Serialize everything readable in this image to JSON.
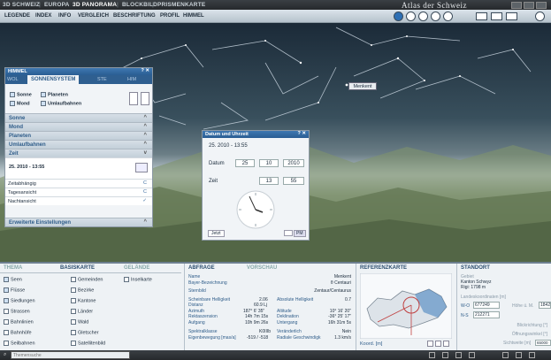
{
  "topbar": {
    "tabs": [
      "3D",
      "SCHWEIZ",
      "EUROPA",
      "3D",
      "PANORAMA",
      "BLOCKBILD",
      "PRISMENKARTE"
    ],
    "app_title": "Atlas der Schweiz"
  },
  "menu": [
    "LEGENDE",
    "INDEX",
    "INFO",
    "VERGLEICH",
    "BESCHRIFTUNG",
    "PROFIL",
    "HIMMEL"
  ],
  "scene": {
    "star_label": "Menkent"
  },
  "himmel": {
    "title": "HIMMEL",
    "tabs": [
      "WOL",
      "SONNENSYSTEM",
      "STE",
      "HIM"
    ],
    "checks": [
      {
        "label": "Sonne",
        "checked": true
      },
      {
        "label": "Planeten",
        "checked": true
      },
      {
        "label": "Mond",
        "checked": true
      },
      {
        "label": "Umlaufbahnen",
        "checked": true
      }
    ],
    "sections": [
      "Sonne",
      "Mond",
      "Planeten",
      "Umlaufbahnen",
      "Zeit"
    ],
    "time_value": "25. 2010 - 13:55",
    "time_rows": [
      "Zeitabhängig",
      "Tagesansicht",
      "Nachtansicht"
    ],
    "extended": "Erweiterte Einstellungen"
  },
  "datum": {
    "title": "Datum und Uhrzeit",
    "summary": "25. 2010 - 13:55",
    "datum_label": "Datum",
    "day": "25",
    "month": "10",
    "year": "2010",
    "zeit_label": "Zeit",
    "hour": "13",
    "minute": "55",
    "jetzt": "Jetzt",
    "pm": "PM"
  },
  "bottom": {
    "thema_tabs": [
      "THEMA",
      "BASISKARTE",
      "GELÄNDE"
    ],
    "basiskarte": [
      {
        "label": "Seen",
        "checked": true
      },
      {
        "label": "Gemeinden",
        "checked": false
      },
      {
        "label": "Inselkarte",
        "checked": false
      },
      {
        "label": "Flüsse",
        "checked": true
      },
      {
        "label": "Bezirke",
        "checked": false
      },
      {
        "label": "Siedlungen",
        "checked": true
      },
      {
        "label": "Kantone",
        "checked": false
      },
      {
        "label": "Strassen",
        "checked": false
      },
      {
        "label": "Länder",
        "checked": false
      },
      {
        "label": "Bahnlinien",
        "checked": false
      },
      {
        "label": "Wald",
        "checked": false
      },
      {
        "label": "Bahnhöfe",
        "checked": false
      },
      {
        "label": "Gletscher",
        "checked": false
      },
      {
        "label": "Seilbahnen",
        "checked": false
      },
      {
        "label": "Satellitenbild",
        "checked": false
      }
    ],
    "abfrage_tabs": [
      "ABFRAGE",
      "VORSCHAU"
    ],
    "abfrage_rows": [
      [
        "Name",
        "Menkent"
      ],
      [
        "Bayer-Bezeichnung",
        "θ Centauri"
      ],
      [
        "Sternbild",
        "Zentaur/Centaurus"
      ],
      [
        "Scheinbare Helligkeit",
        "2.06",
        "Absolute Helligkeit",
        "0.7"
      ],
      [
        "Distanz",
        "60.9 Lj"
      ],
      [
        "Azimuth",
        "187° 6' 35\"",
        "Altitude",
        "10° 16' 20\""
      ],
      [
        "Rektaszension",
        "14h 7m 15s",
        "Deklination",
        "-36° 25' 17\""
      ],
      [
        "Aufgang",
        "10h 9m 26s",
        "Untergang",
        "16h 31m 5s"
      ],
      [
        "Spektralklasse",
        "K0IIIb",
        "Veränderlich",
        "Nein"
      ],
      [
        "Eigenbewegung [mas/a]",
        "-519 / -518",
        "Radiale Geschwindigk",
        "1.3 km/s"
      ]
    ],
    "ref_title": "REFERENZKARTE",
    "ref_koord": "Koord. [m]",
    "standort": {
      "title": "STANDORT",
      "gebiet_label": "Gebiet",
      "gebiet_value": "Kanton Schwyz",
      "rigi": "Rigi: 1798 m",
      "landes_label": "Landeskoordinaten [m]",
      "wo_label": "W-O",
      "wo_value": "677249",
      "ns_label": "N-S",
      "ns_value": "212271",
      "hoehe_label": "Höhe ü. M.",
      "hoehe_value": "1842",
      "blick_label": "Blickrichtung [°]",
      "oeffnung_label": "Öffnungswinkel [°]",
      "sicht_label": "Sichtweite [m]",
      "sicht_value": "65000"
    }
  },
  "statusbar": {
    "search_placeholder": "Themensuche"
  },
  "colors": {
    "accent": "#2f5d8a",
    "sky": "#1b2a38",
    "panel": "#f1f4f7"
  }
}
